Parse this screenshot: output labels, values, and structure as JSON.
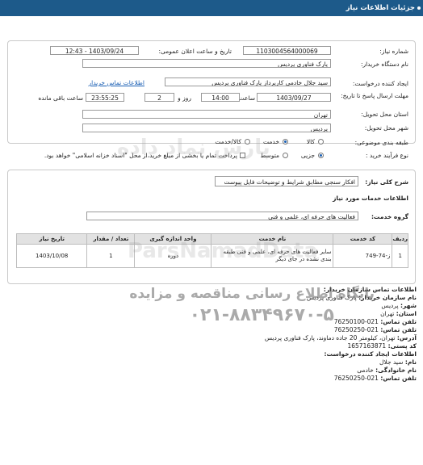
{
  "header": {
    "title": "جزئیات اطلاعات نیاز"
  },
  "fields": {
    "need_number_label": "شماره نیاز:",
    "need_number": "1103004564000069",
    "announce_label": "تاریخ و ساعت اعلان عمومی:",
    "announce_value": "1403/09/24 - 12:43",
    "buyer_org_label": "نام دستگاه خریدار:",
    "buyer_org": "پارک فناوری پردیس",
    "requester_label": "ایجاد کننده درخواست:",
    "requester": "سید جلال خادمی کارپرداز پارک فناوری پردیس",
    "contact_link": "اطلاعات تماس خریدار",
    "deadline_label": "مهلت ارسال پاسخ تا تاریخ:",
    "deadline_date": "1403/09/27",
    "time_label": "ساعت",
    "deadline_time": "14:00",
    "days_value": "2",
    "days_label": "روز و",
    "remaining_time": "23:55:25",
    "remaining_label": "ساعت باقی مانده",
    "province_label": "استان محل تحویل:",
    "province": "تهران",
    "city_label": "شهر محل تحویل:",
    "city": "پردیس",
    "category_label": "طبقه بندی موضوعی:",
    "category_options": [
      "کالا",
      "خدمت",
      "کالا/خدمت"
    ],
    "category_selected": "خدمت",
    "purchase_label": "نوع فرآیند خرید :",
    "purchase_options": [
      "جزیی",
      "متوسط"
    ],
    "purchase_selected": "جزیی",
    "payment_note": "پرداخت تمام یا بخشی از مبلغ خرید،از محل \"اسناد خزانه اسلامی\" خواهد بود."
  },
  "needs": {
    "summary_label": "شرح کلی نیاز:",
    "summary": "افکار سنجی مطابق شرایط و توضیحات فایل پیوست",
    "services_title": "اطلاعات خدمات مورد نیاز",
    "group_label": "گروه خدمت:",
    "group": "فعالیت های حرفه ای، علمی و فنی"
  },
  "table": {
    "headers": [
      "ردیف",
      "کد خدمت",
      "نام خدمت",
      "واحد اندازه گیری",
      "تعداد / مقدار",
      "تاریخ نیاز"
    ],
    "rows": [
      [
        "1",
        "ز-74-749",
        "سایر فعالیت های حرفه ای، علمی و فنی طبقه بندی نشده در جای دیگر",
        "دوره",
        "1",
        "1403/10/08"
      ]
    ]
  },
  "watermarks": {
    "brand": "ParsNamadData",
    "fa_line1": "پایگاه اطلاع رسانی مناقصه و مزایده",
    "fa_line2": "پارس نماد داده",
    "phone": "۰۲۱-۸۸۳۴۹۶۷۰-۵"
  },
  "contact": {
    "title": "اطلاعات تماس سازمان خریدار:",
    "buyer_name_label": "نام سازمان خریدار:",
    "buyer_name": "پارک فناوری پردیس",
    "city_label": "شهر:",
    "city": "پردیس",
    "province_label": "استان:",
    "province": "تهران",
    "phone_label": "تلفن تماس:",
    "phone": "021-76250100",
    "fax_label": "تلفن تماس:",
    "fax": "021-76250250",
    "address_label": "آدرس:",
    "address": "تهران، کیلومتر 20 جاده دماوند، پارک فناوری پردیس",
    "postal_label": "کد پستی:",
    "postal": "1657163871",
    "creator_title": "اطلاعات ایجاد کننده درخواست:",
    "first_name_label": "نام:",
    "first_name": "سید جلال",
    "last_name_label": "نام خانوادگی:",
    "last_name": "خادمی",
    "creator_phone_label": "تلفن تماس:",
    "creator_phone": "021-76250250"
  }
}
